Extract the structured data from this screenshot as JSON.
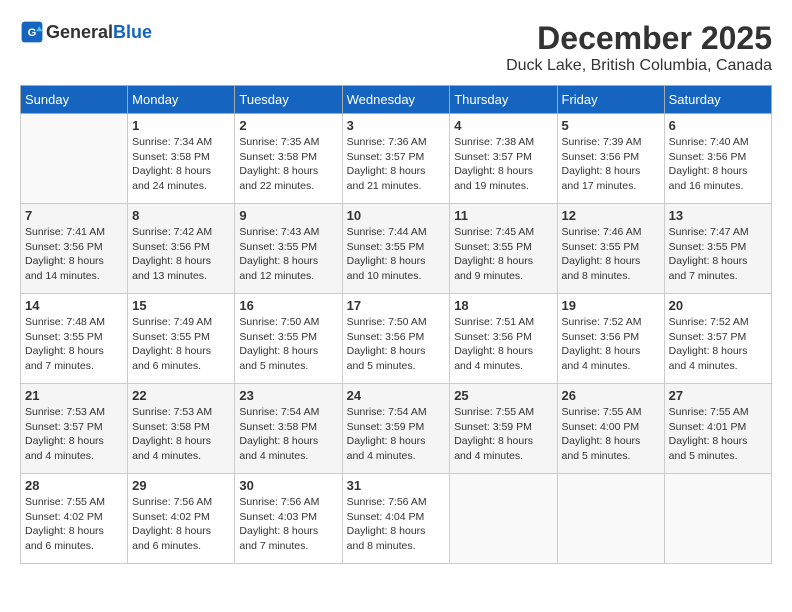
{
  "header": {
    "logo_general": "General",
    "logo_blue": "Blue",
    "title": "December 2025",
    "subtitle": "Duck Lake, British Columbia, Canada"
  },
  "calendar": {
    "days_of_week": [
      "Sunday",
      "Monday",
      "Tuesday",
      "Wednesday",
      "Thursday",
      "Friday",
      "Saturday"
    ],
    "weeks": [
      [
        {
          "day": "",
          "info": ""
        },
        {
          "day": "1",
          "info": "Sunrise: 7:34 AM\nSunset: 3:58 PM\nDaylight: 8 hours\nand 24 minutes."
        },
        {
          "day": "2",
          "info": "Sunrise: 7:35 AM\nSunset: 3:58 PM\nDaylight: 8 hours\nand 22 minutes."
        },
        {
          "day": "3",
          "info": "Sunrise: 7:36 AM\nSunset: 3:57 PM\nDaylight: 8 hours\nand 21 minutes."
        },
        {
          "day": "4",
          "info": "Sunrise: 7:38 AM\nSunset: 3:57 PM\nDaylight: 8 hours\nand 19 minutes."
        },
        {
          "day": "5",
          "info": "Sunrise: 7:39 AM\nSunset: 3:56 PM\nDaylight: 8 hours\nand 17 minutes."
        },
        {
          "day": "6",
          "info": "Sunrise: 7:40 AM\nSunset: 3:56 PM\nDaylight: 8 hours\nand 16 minutes."
        }
      ],
      [
        {
          "day": "7",
          "info": "Sunrise: 7:41 AM\nSunset: 3:56 PM\nDaylight: 8 hours\nand 14 minutes."
        },
        {
          "day": "8",
          "info": "Sunrise: 7:42 AM\nSunset: 3:56 PM\nDaylight: 8 hours\nand 13 minutes."
        },
        {
          "day": "9",
          "info": "Sunrise: 7:43 AM\nSunset: 3:55 PM\nDaylight: 8 hours\nand 12 minutes."
        },
        {
          "day": "10",
          "info": "Sunrise: 7:44 AM\nSunset: 3:55 PM\nDaylight: 8 hours\nand 10 minutes."
        },
        {
          "day": "11",
          "info": "Sunrise: 7:45 AM\nSunset: 3:55 PM\nDaylight: 8 hours\nand 9 minutes."
        },
        {
          "day": "12",
          "info": "Sunrise: 7:46 AM\nSunset: 3:55 PM\nDaylight: 8 hours\nand 8 minutes."
        },
        {
          "day": "13",
          "info": "Sunrise: 7:47 AM\nSunset: 3:55 PM\nDaylight: 8 hours\nand 7 minutes."
        }
      ],
      [
        {
          "day": "14",
          "info": "Sunrise: 7:48 AM\nSunset: 3:55 PM\nDaylight: 8 hours\nand 7 minutes."
        },
        {
          "day": "15",
          "info": "Sunrise: 7:49 AM\nSunset: 3:55 PM\nDaylight: 8 hours\nand 6 minutes."
        },
        {
          "day": "16",
          "info": "Sunrise: 7:50 AM\nSunset: 3:55 PM\nDaylight: 8 hours\nand 5 minutes."
        },
        {
          "day": "17",
          "info": "Sunrise: 7:50 AM\nSunset: 3:56 PM\nDaylight: 8 hours\nand 5 minutes."
        },
        {
          "day": "18",
          "info": "Sunrise: 7:51 AM\nSunset: 3:56 PM\nDaylight: 8 hours\nand 4 minutes."
        },
        {
          "day": "19",
          "info": "Sunrise: 7:52 AM\nSunset: 3:56 PM\nDaylight: 8 hours\nand 4 minutes."
        },
        {
          "day": "20",
          "info": "Sunrise: 7:52 AM\nSunset: 3:57 PM\nDaylight: 8 hours\nand 4 minutes."
        }
      ],
      [
        {
          "day": "21",
          "info": "Sunrise: 7:53 AM\nSunset: 3:57 PM\nDaylight: 8 hours\nand 4 minutes."
        },
        {
          "day": "22",
          "info": "Sunrise: 7:53 AM\nSunset: 3:58 PM\nDaylight: 8 hours\nand 4 minutes."
        },
        {
          "day": "23",
          "info": "Sunrise: 7:54 AM\nSunset: 3:58 PM\nDaylight: 8 hours\nand 4 minutes."
        },
        {
          "day": "24",
          "info": "Sunrise: 7:54 AM\nSunset: 3:59 PM\nDaylight: 8 hours\nand 4 minutes."
        },
        {
          "day": "25",
          "info": "Sunrise: 7:55 AM\nSunset: 3:59 PM\nDaylight: 8 hours\nand 4 minutes."
        },
        {
          "day": "26",
          "info": "Sunrise: 7:55 AM\nSunset: 4:00 PM\nDaylight: 8 hours\nand 5 minutes."
        },
        {
          "day": "27",
          "info": "Sunrise: 7:55 AM\nSunset: 4:01 PM\nDaylight: 8 hours\nand 5 minutes."
        }
      ],
      [
        {
          "day": "28",
          "info": "Sunrise: 7:55 AM\nSunset: 4:02 PM\nDaylight: 8 hours\nand 6 minutes."
        },
        {
          "day": "29",
          "info": "Sunrise: 7:56 AM\nSunset: 4:02 PM\nDaylight: 8 hours\nand 6 minutes."
        },
        {
          "day": "30",
          "info": "Sunrise: 7:56 AM\nSunset: 4:03 PM\nDaylight: 8 hours\nand 7 minutes."
        },
        {
          "day": "31",
          "info": "Sunrise: 7:56 AM\nSunset: 4:04 PM\nDaylight: 8 hours\nand 8 minutes."
        },
        {
          "day": "",
          "info": ""
        },
        {
          "day": "",
          "info": ""
        },
        {
          "day": "",
          "info": ""
        }
      ]
    ]
  }
}
